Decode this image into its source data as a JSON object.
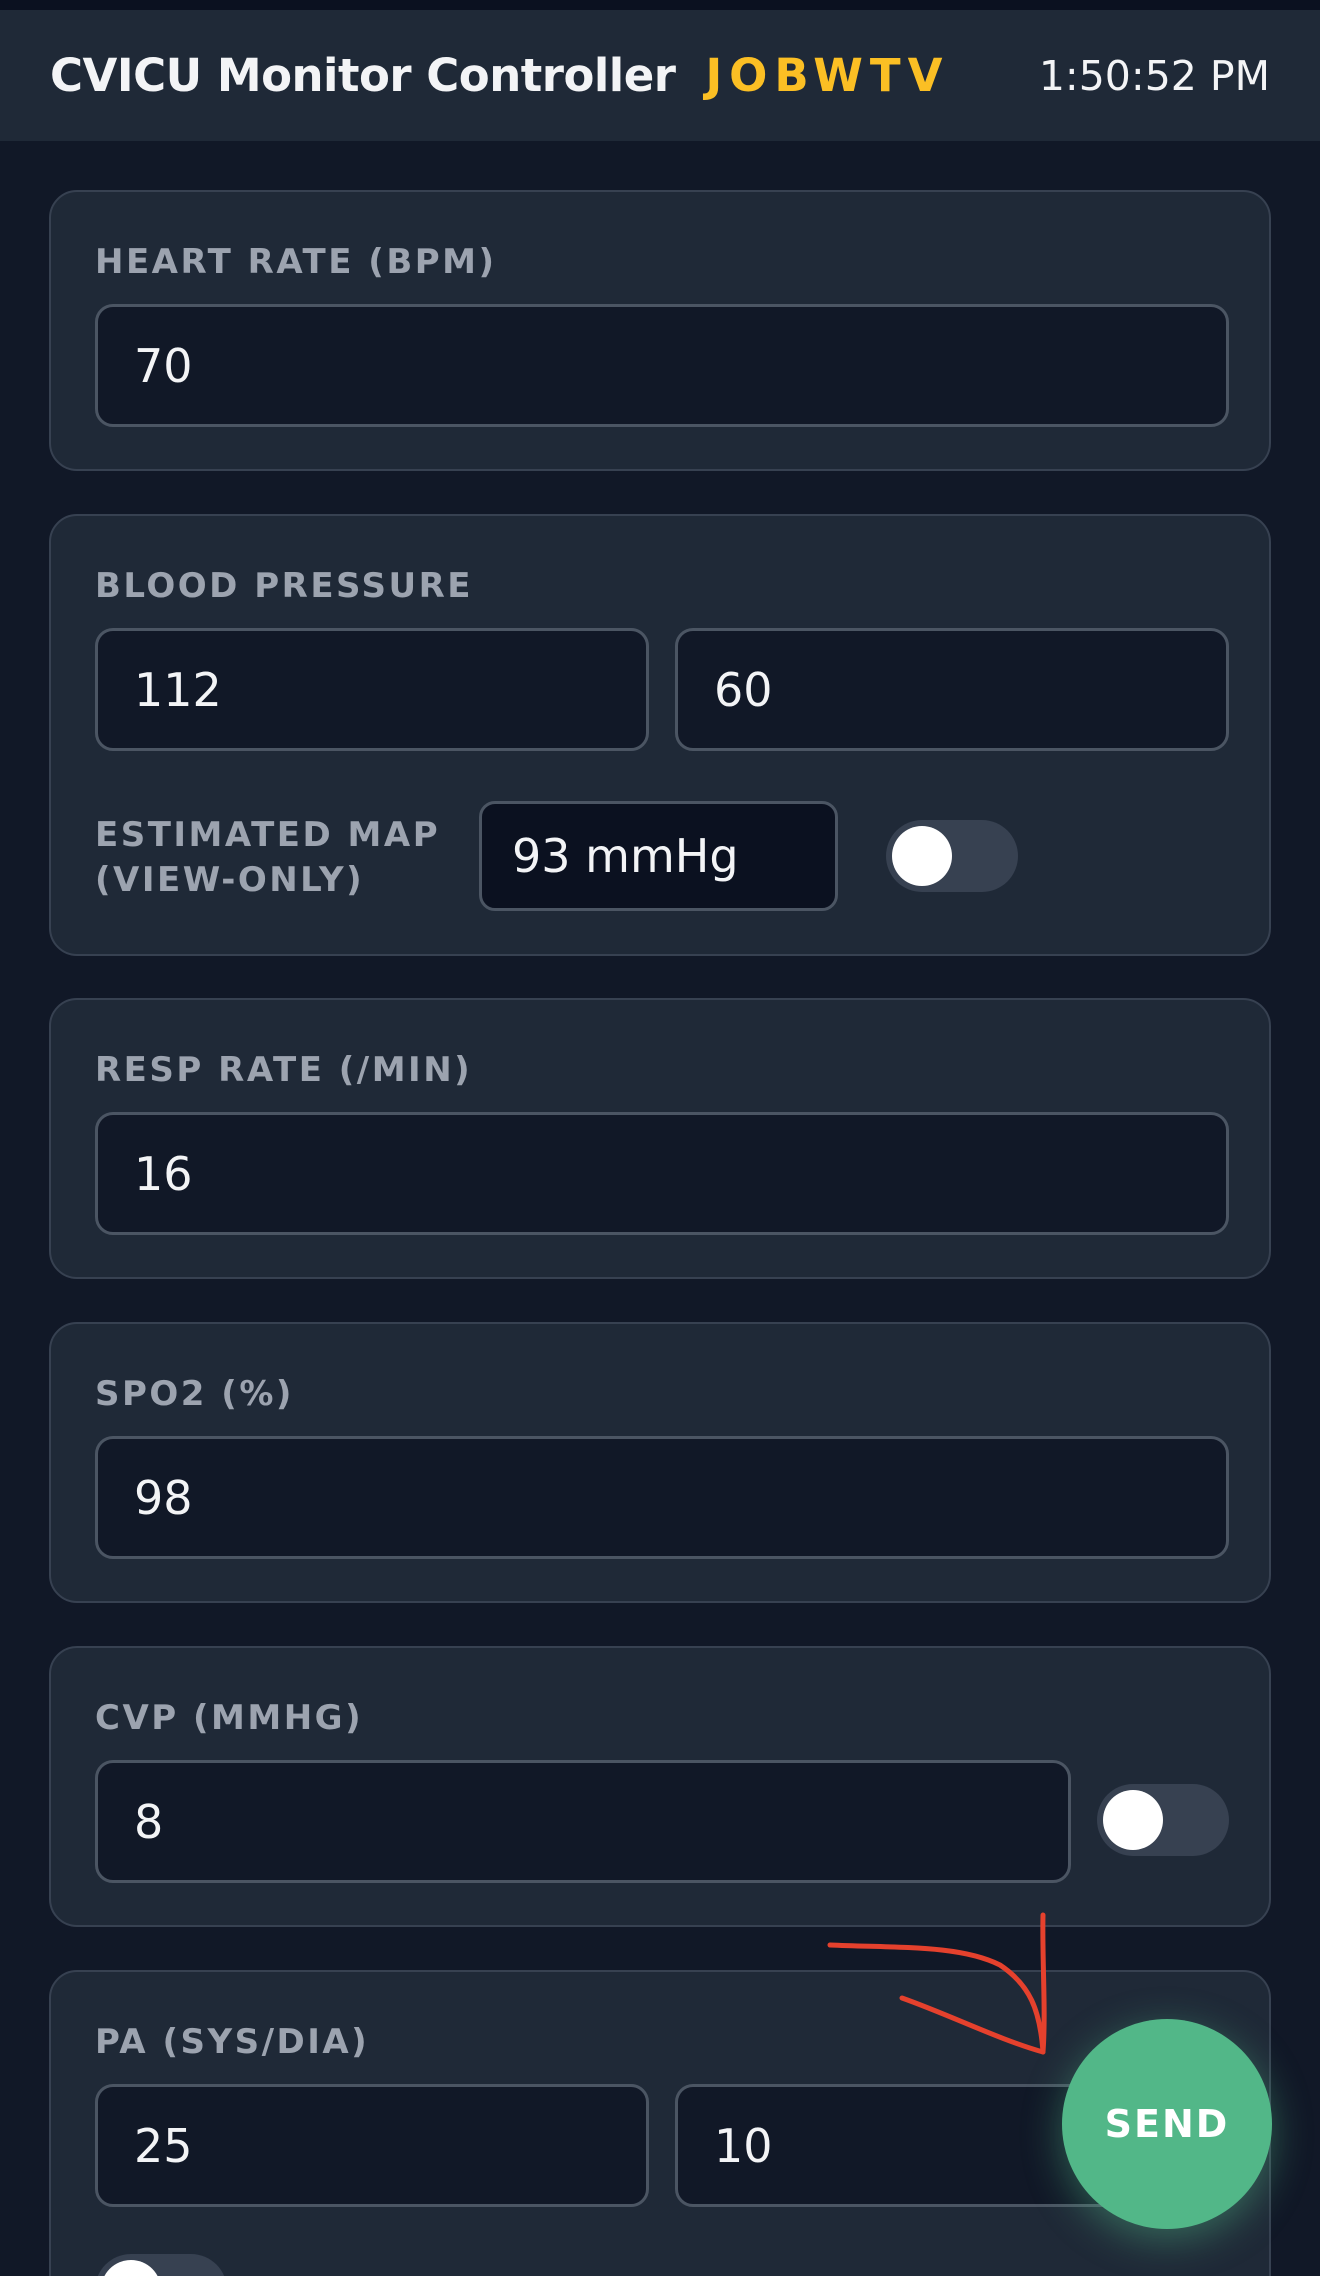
{
  "header": {
    "title": "CVICU Monitor Controller",
    "room_code": "JOBWTV",
    "clock": "1:50:52 PM"
  },
  "heart_rate": {
    "label": "HEART RATE (BPM)",
    "value": "70"
  },
  "blood_pressure": {
    "label": "BLOOD PRESSURE",
    "systolic": "112",
    "diastolic": "60",
    "map_label_line1": "ESTIMATED MAP",
    "map_label_line2": "(VIEW-ONLY)",
    "map_value": "93 mmHg",
    "toggle_on": false
  },
  "resp_rate": {
    "label": "RESP RATE (/MIN)",
    "value": "16"
  },
  "spo2": {
    "label": "SPO2 (%)",
    "value": "98"
  },
  "cvp": {
    "label": "CVP (MMHG)",
    "value": "8",
    "toggle_on": false
  },
  "pa": {
    "label": "PA (SYS/DIA)",
    "systolic": "25",
    "diastolic": "10",
    "toggle_on": false
  },
  "send_button": {
    "label": "SEND"
  },
  "colors": {
    "accent": "#fbbf24",
    "send": "#52b788",
    "annotation": "#e5412d"
  }
}
